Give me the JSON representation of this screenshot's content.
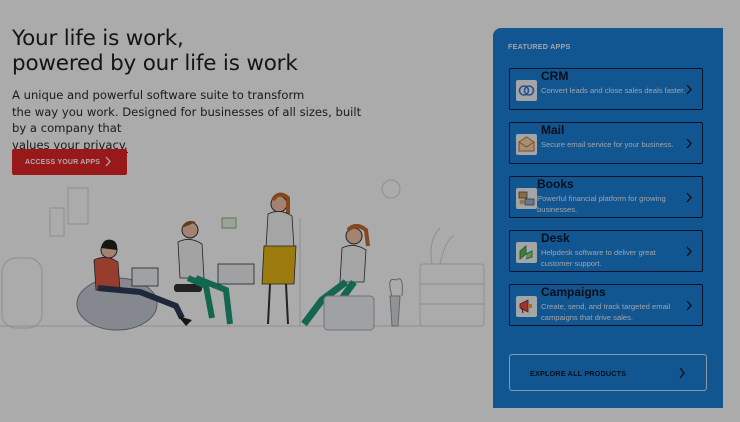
{
  "hero": {
    "headline_line1": "Your life is work,",
    "headline_line2": "powered by our life is work",
    "sub_line1": "A unique and powerful software suite to transform",
    "sub_line2": "the way you work. Designed for businesses of all sizes, built",
    "sub_line3_prefix": "by a company that ",
    "privacy_link": "values your privacy.",
    "cta_label": "ACCESS YOUR APPS"
  },
  "featured": {
    "heading": "FEATURED APPS",
    "apps": [
      {
        "name": "CRM",
        "description": "Convert leads and close sales deals faster.",
        "icon": "crm-icon"
      },
      {
        "name": "Mail",
        "description": "Secure email service for your business.",
        "icon": "mail-icon"
      },
      {
        "name": "Books",
        "description": "Powerful financial platform for growing businesses.",
        "icon": "books-icon"
      },
      {
        "name": "Desk",
        "description": "Helpdesk software to deliver great customer support.",
        "icon": "desk-icon"
      },
      {
        "name": "Campaigns",
        "description": "Create, send, and track targeted email campaigns that drive sales.",
        "icon": "campaigns-icon"
      }
    ],
    "explore_label": "EXPLORE ALL PRODUCTS"
  },
  "colors": {
    "cta": "#e42527",
    "panel": "#1a7fd9",
    "overlay": "rgba(0,0,0,0.33)"
  }
}
